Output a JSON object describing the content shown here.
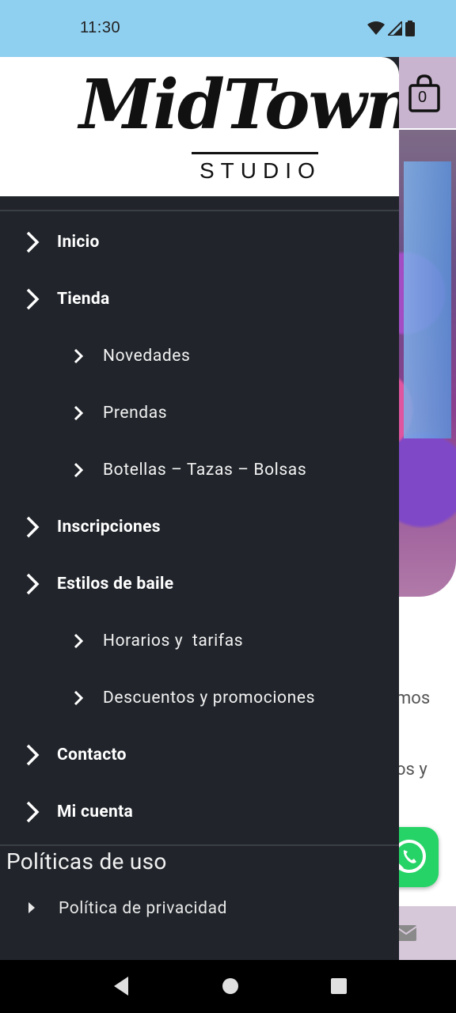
{
  "status_bar": {
    "time": "11:30"
  },
  "brand": {
    "logo_script": "MidTown",
    "logo_sub": "STUDIO"
  },
  "cart": {
    "count": "0"
  },
  "menu": {
    "items": [
      {
        "label": "Inicio",
        "level": "top"
      },
      {
        "label": "Tienda",
        "level": "top"
      },
      {
        "label": "Novedades",
        "level": "sub"
      },
      {
        "label": "Prendas",
        "level": "sub"
      },
      {
        "label": "Botellas – Tazas – Bolsas",
        "level": "sub"
      },
      {
        "label": "Inscripciones",
        "level": "top"
      },
      {
        "label": "Estilos de baile",
        "level": "top"
      },
      {
        "label": "Horarios y  tarifas",
        "level": "sub"
      },
      {
        "label": "Descuentos y promociones",
        "level": "sub"
      },
      {
        "label": "Contacto",
        "level": "top"
      },
      {
        "label": "Mi cuenta",
        "level": "top"
      }
    ]
  },
  "policies": {
    "title": "Políticas de uso",
    "items": [
      {
        "label": "Política de privacidad"
      }
    ]
  },
  "background": {
    "text_fragment_1": "mos",
    "text_fragment_2": "os y"
  },
  "colors": {
    "status_bar": "#8fcff0",
    "drawer_bg": "#21252b",
    "whatsapp": "#25d366",
    "page_header": "#c9b4cf"
  },
  "icons": [
    "wifi-icon",
    "cell-signal-icon",
    "battery-icon",
    "cart-icon",
    "chevron-right-icon",
    "whatsapp-icon",
    "mail-icon",
    "back-icon",
    "home-icon",
    "recents-icon"
  ]
}
